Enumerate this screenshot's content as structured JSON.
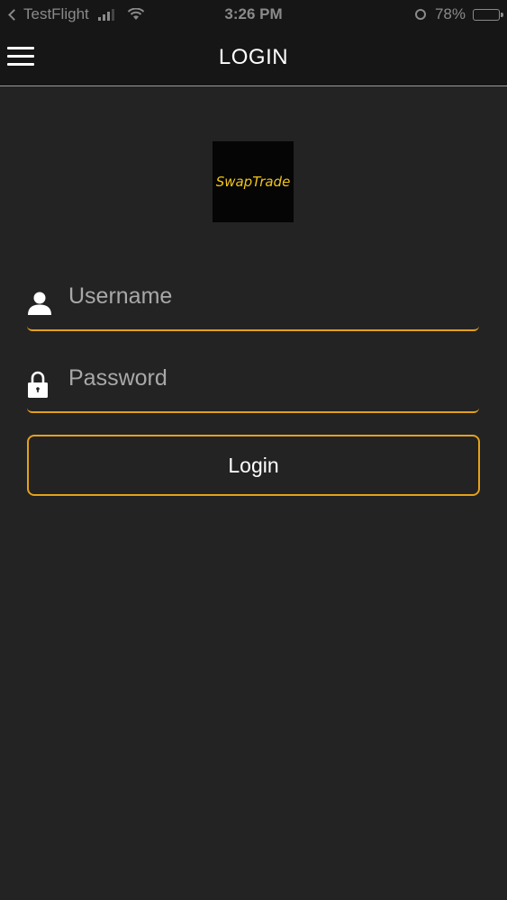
{
  "status_bar": {
    "app_back_label": "TestFlight",
    "time": "3:26 PM",
    "battery_percent": "78%",
    "battery_level": 0.78,
    "battery_color": "#4cd964"
  },
  "nav": {
    "title": "LOGIN",
    "menu_icon": "hamburger-menu-icon"
  },
  "logo": {
    "text": "SwapTrade",
    "text_color": "#f0c419"
  },
  "form": {
    "username": {
      "placeholder": "Username",
      "value": "",
      "icon": "user-icon"
    },
    "password": {
      "placeholder": "Password",
      "value": "",
      "icon": "lock-icon"
    },
    "login_label": "Login",
    "accent_color": "#e4a11b"
  }
}
